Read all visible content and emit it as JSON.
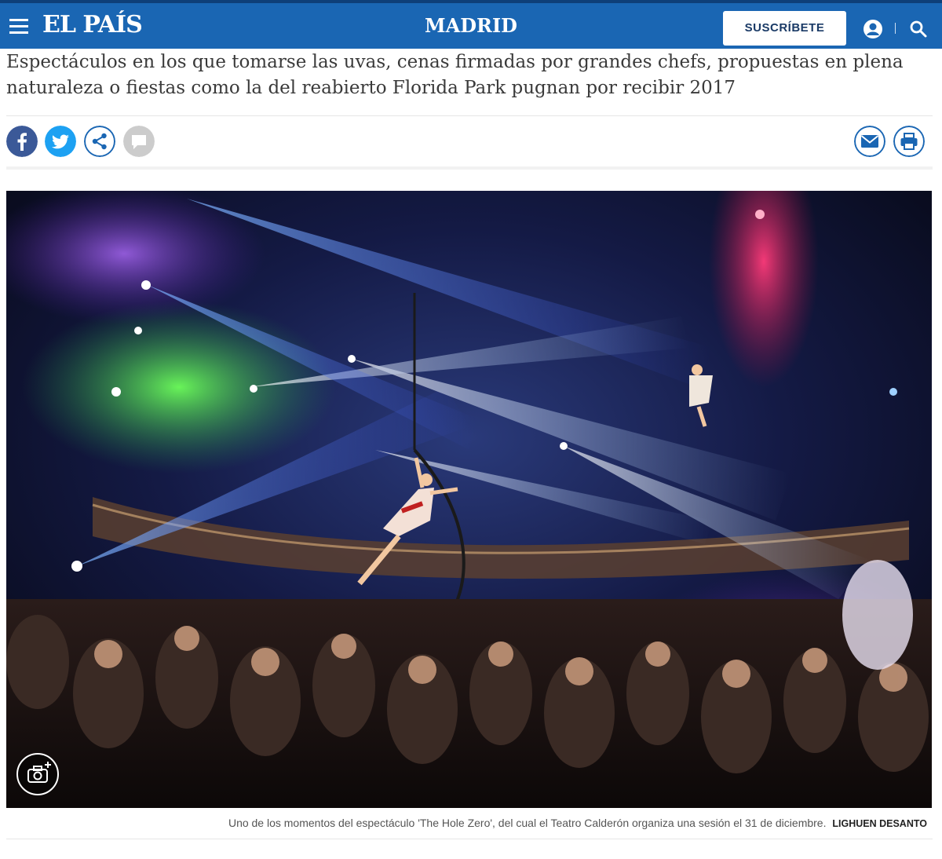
{
  "header": {
    "logo": "EL PAÍS",
    "section": "MADRID",
    "subscribe_label": "SUSCRÍBETE",
    "icons": [
      "hamburger-menu-icon",
      "user-icon",
      "search-icon"
    ],
    "brand_color": "#1a66b3"
  },
  "article": {
    "subtitle": "Espectáculos en los que tomarse las uvas, cenas firmadas por grandes chefs, propuestas en plena naturaleza o fiestas como la del reabierto Florida Park pugnan por recibir 2017"
  },
  "share": {
    "buttons": [
      {
        "name": "facebook",
        "icon": "facebook-icon",
        "color": "#3b5998"
      },
      {
        "name": "twitter",
        "icon": "twitter-icon",
        "color": "#1da1f2"
      },
      {
        "name": "share",
        "icon": "share-icon",
        "color": "#1a66b3"
      },
      {
        "name": "comments",
        "icon": "comment-icon",
        "color": "#cccccc"
      },
      {
        "name": "email",
        "icon": "email-icon",
        "color": "#1a66b3"
      },
      {
        "name": "print",
        "icon": "print-icon",
        "color": "#1a66b3"
      }
    ]
  },
  "photo": {
    "icon": "camera-gallery-icon",
    "caption": "Uno de los momentos del espectáculo 'The Hole Zero', del cual el Teatro Calderón organiza una sesión el 31 de diciembre.",
    "credit": "LIGHUEN DESANTO"
  }
}
